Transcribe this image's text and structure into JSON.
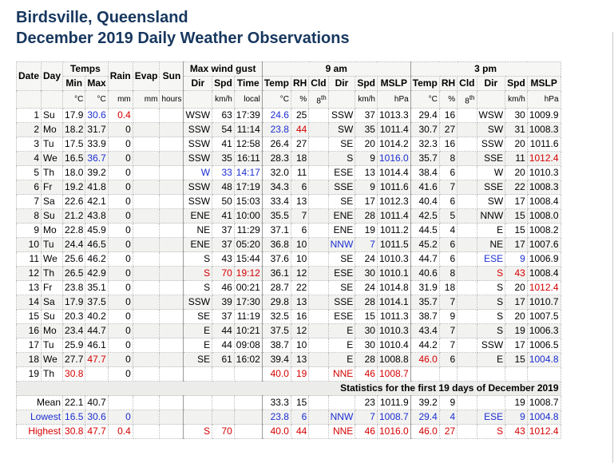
{
  "title_line1": "Birdsville, Queensland",
  "title_line2": "December 2019 Daily Weather Observations",
  "headers": {
    "date": "Date",
    "day": "Day",
    "temps": "Temps",
    "min": "Min",
    "max": "Max",
    "rain": "Rain",
    "evap": "Evap",
    "sun": "Sun",
    "max_wind_gust": "Max wind gust",
    "dir": "Dir",
    "spd": "Spd",
    "time": "Time",
    "am": "9 am",
    "pm": "3 pm",
    "temp": "Temp",
    "rh": "RH",
    "cld": "Cld",
    "mslp": "MSLP"
  },
  "units": {
    "c": "°C",
    "mm": "mm",
    "hours": "hours",
    "kmh": "km/h",
    "local": "local",
    "pct": "%",
    "okta": "8",
    "okta_sup": "th",
    "hpa": "hPa"
  },
  "rows": [
    [
      "1",
      "Su",
      "17.9",
      "30.6",
      "0.4",
      "",
      "",
      "WSW",
      "63",
      "17:39",
      "24.6",
      "25",
      "",
      "SSW",
      "37",
      "1013.3",
      "29.4",
      "16",
      "",
      "WSW",
      "30",
      "1009.9"
    ],
    [
      "2",
      "Mo",
      "18.2",
      "31.7",
      "0",
      "",
      "",
      "SSW",
      "54",
      "11:14",
      "23.8",
      "44",
      "",
      "SW",
      "35",
      "1011.4",
      "30.7",
      "27",
      "",
      "SW",
      "31",
      "1008.3"
    ],
    [
      "3",
      "Tu",
      "17.5",
      "33.9",
      "0",
      "",
      "",
      "SSW",
      "41",
      "12:58",
      "26.4",
      "27",
      "",
      "SE",
      "20",
      "1014.2",
      "32.3",
      "16",
      "",
      "SSW",
      "20",
      "1011.6"
    ],
    [
      "4",
      "We",
      "16.5",
      "36.7",
      "0",
      "",
      "",
      "SSW",
      "35",
      "16:11",
      "28.3",
      "18",
      "",
      "S",
      "9",
      "1016.0",
      "35.7",
      "8",
      "",
      "SSE",
      "11",
      "1012.4"
    ],
    [
      "5",
      "Th",
      "18.0",
      "39.2",
      "0",
      "",
      "",
      "W",
      "33",
      "14:17",
      "32.0",
      "11",
      "",
      "ESE",
      "13",
      "1014.4",
      "38.4",
      "6",
      "",
      "W",
      "20",
      "1010.3"
    ],
    [
      "6",
      "Fr",
      "19.2",
      "41.8",
      "0",
      "",
      "",
      "SSW",
      "48",
      "17:19",
      "34.3",
      "6",
      "",
      "SSE",
      "9",
      "1011.6",
      "41.6",
      "7",
      "",
      "SSE",
      "22",
      "1008.3"
    ],
    [
      "7",
      "Sa",
      "22.6",
      "42.1",
      "0",
      "",
      "",
      "SSW",
      "50",
      "15:03",
      "33.4",
      "13",
      "",
      "SE",
      "17",
      "1012.3",
      "40.4",
      "6",
      "",
      "SW",
      "17",
      "1008.4"
    ],
    [
      "8",
      "Su",
      "21.2",
      "43.8",
      "0",
      "",
      "",
      "ENE",
      "41",
      "10:00",
      "35.5",
      "7",
      "",
      "ENE",
      "28",
      "1011.4",
      "42.5",
      "5",
      "",
      "NNW",
      "15",
      "1008.0"
    ],
    [
      "9",
      "Mo",
      "22.8",
      "45.9",
      "0",
      "",
      "",
      "NE",
      "37",
      "11:29",
      "37.1",
      "6",
      "",
      "ENE",
      "19",
      "1011.2",
      "44.5",
      "4",
      "",
      "E",
      "15",
      "1008.2"
    ],
    [
      "10",
      "Tu",
      "24.4",
      "46.5",
      "0",
      "",
      "",
      "ENE",
      "37",
      "05:20",
      "36.8",
      "10",
      "",
      "NNW",
      "7",
      "1011.5",
      "45.2",
      "6",
      "",
      "NE",
      "17",
      "1007.6"
    ],
    [
      "11",
      "We",
      "25.6",
      "46.2",
      "0",
      "",
      "",
      "S",
      "43",
      "15:44",
      "37.6",
      "10",
      "",
      "SE",
      "24",
      "1010.3",
      "44.7",
      "6",
      "",
      "ESE",
      "9",
      "1006.9"
    ],
    [
      "12",
      "Th",
      "26.5",
      "42.9",
      "0",
      "",
      "",
      "S",
      "70",
      "19:12",
      "36.1",
      "12",
      "",
      "ESE",
      "30",
      "1010.1",
      "40.6",
      "8",
      "",
      "S",
      "43",
      "1008.4"
    ],
    [
      "13",
      "Fr",
      "23.8",
      "35.1",
      "0",
      "",
      "",
      "S",
      "46",
      "00:21",
      "28.7",
      "22",
      "",
      "SE",
      "24",
      "1014.8",
      "31.9",
      "18",
      "",
      "S",
      "20",
      "1012.4"
    ],
    [
      "14",
      "Sa",
      "17.9",
      "37.5",
      "0",
      "",
      "",
      "SSW",
      "39",
      "17:30",
      "29.8",
      "13",
      "",
      "SSE",
      "28",
      "1014.1",
      "35.7",
      "7",
      "",
      "S",
      "17",
      "1010.7"
    ],
    [
      "15",
      "Su",
      "20.3",
      "40.2",
      "0",
      "",
      "",
      "SE",
      "37",
      "11:19",
      "32.5",
      "16",
      "",
      "ESE",
      "15",
      "1011.3",
      "38.7",
      "9",
      "",
      "S",
      "20",
      "1007.5"
    ],
    [
      "16",
      "Mo",
      "23.4",
      "44.7",
      "0",
      "",
      "",
      "E",
      "44",
      "10:21",
      "37.5",
      "12",
      "",
      "E",
      "30",
      "1010.3",
      "43.4",
      "7",
      "",
      "S",
      "19",
      "1006.3"
    ],
    [
      "17",
      "Tu",
      "25.9",
      "46.1",
      "0",
      "",
      "",
      "E",
      "44",
      "09:08",
      "38.7",
      "10",
      "",
      "E",
      "30",
      "1010.4",
      "44.2",
      "7",
      "",
      "SSW",
      "17",
      "1006.5"
    ],
    [
      "18",
      "We",
      "27.7",
      "47.7",
      "0",
      "",
      "",
      "SE",
      "61",
      "16:02",
      "39.4",
      "13",
      "",
      "E",
      "28",
      "1008.8",
      "46.0",
      "6",
      "",
      "E",
      "15",
      "1004.8"
    ],
    [
      "19",
      "Th",
      "30.8",
      "",
      "0",
      "",
      "",
      "",
      "",
      "",
      "40.0",
      "19",
      "",
      "NNE",
      "46",
      "1008.7",
      "",
      "",
      "",
      "",
      "",
      ""
    ]
  ],
  "colors": {
    "blue": [
      "0-3",
      "0-10",
      "1-10",
      "3-3",
      "3-15",
      "4-7",
      "4-8",
      "4-9",
      "9-13",
      "9-14",
      "10-19",
      "10-20",
      "17-21"
    ],
    "red": [
      "0-4",
      "1-11",
      "3-21",
      "11-7",
      "11-8",
      "11-9",
      "11-19",
      "11-20",
      "12-21",
      "17-3",
      "17-16",
      "18-2",
      "18-10",
      "18-11",
      "18-13",
      "18-14",
      "18-15"
    ]
  },
  "stats": {
    "title": "Statistics for the first 19 days of December 2019",
    "rows": [
      {
        "label": "Mean",
        "vals": [
          "22.1",
          "40.7",
          "",
          "",
          "",
          "",
          "",
          "",
          "33.3",
          "15",
          "",
          "",
          "23",
          "1011.9",
          "39.2",
          "9",
          "",
          "",
          "19",
          "1008.7"
        ]
      },
      {
        "label": "Lowest",
        "vals": [
          "16.5",
          "30.6",
          "0",
          "",
          "",
          "",
          "",
          "",
          "23.8",
          "6",
          "",
          "NNW",
          "7",
          "1008.7",
          "29.4",
          "4",
          "",
          "ESE",
          "9",
          "1004.8"
        ]
      },
      {
        "label": "Highest",
        "vals": [
          "30.8",
          "47.7",
          "0.4",
          "",
          "",
          "S",
          "70",
          "",
          "40.0",
          "44",
          "",
          "NNE",
          "46",
          "1016.0",
          "46.0",
          "27",
          "",
          "S",
          "43",
          "1012.4"
        ]
      }
    ]
  }
}
